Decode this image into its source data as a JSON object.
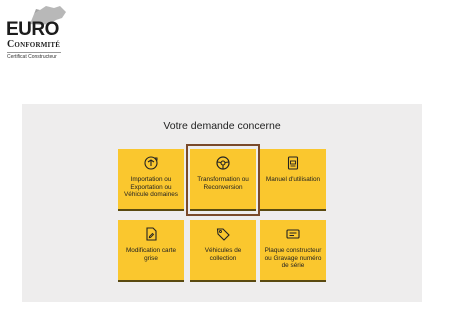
{
  "logo": {
    "line1": "EURO",
    "line2": "Conformité",
    "line3": "Certificat Constructeur"
  },
  "panel": {
    "title": "Votre demande concerne"
  },
  "tiles": [
    {
      "label": "Importation ou Exportation ou Véhicule domaines",
      "icon": "import-export-icon",
      "selected": false
    },
    {
      "label": "Transformation ou Reconversion",
      "icon": "steering-wheel-icon",
      "selected": true
    },
    {
      "label": "Manuel d'utilisation",
      "icon": "manual-icon",
      "selected": false
    },
    {
      "label": "Modification carte grise",
      "icon": "document-edit-icon",
      "selected": false
    },
    {
      "label": "Véhicules de collection",
      "icon": "tag-icon",
      "selected": false
    },
    {
      "label": "Plaque constructeur ou Gravage numéro de série",
      "icon": "plate-icon",
      "selected": false
    }
  ],
  "colors": {
    "tile": "#fac72e",
    "panel": "#eeeded",
    "selected_border": "#7a4a2a"
  }
}
